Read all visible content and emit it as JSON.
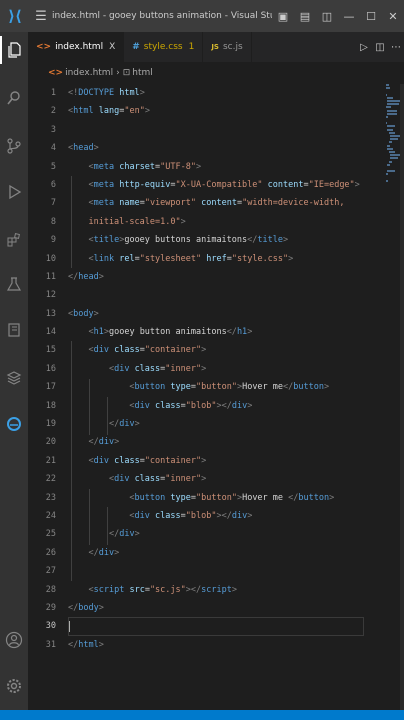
{
  "window": {
    "title": "index.html - gooey buttons animation - Visual Studio Code"
  },
  "tabs": [
    {
      "name": "index.html",
      "icon": "<>",
      "active": true,
      "close": "X"
    },
    {
      "name": "style.css",
      "icon": "#",
      "badge": "1"
    },
    {
      "name": "sc.js",
      "icon": "JS"
    }
  ],
  "breadcrumb": {
    "file": "index.html",
    "element": "html"
  },
  "lines": [
    [
      [
        "p",
        "<!"
      ],
      [
        "t",
        "DOCTYPE"
      ],
      [
        "x",
        " "
      ],
      [
        "a",
        "html"
      ],
      [
        "p",
        ">"
      ]
    ],
    [
      [
        "p",
        "<"
      ],
      [
        "t",
        "html"
      ],
      [
        "x",
        " "
      ],
      [
        "a",
        "lang"
      ],
      [
        "x",
        "="
      ],
      [
        "v",
        "\"en\""
      ],
      [
        "p",
        ">"
      ]
    ],
    [],
    [
      [
        "p",
        "<"
      ],
      [
        "t",
        "head"
      ],
      [
        "p",
        ">"
      ]
    ],
    [
      [
        "x",
        "    "
      ],
      [
        "p",
        "<"
      ],
      [
        "t",
        "meta"
      ],
      [
        "x",
        " "
      ],
      [
        "a",
        "charset"
      ],
      [
        "x",
        "="
      ],
      [
        "v",
        "\"UTF-8\""
      ],
      [
        "p",
        ">"
      ]
    ],
    [
      [
        "x",
        "    "
      ],
      [
        "p",
        "<"
      ],
      [
        "t",
        "meta"
      ],
      [
        "x",
        " "
      ],
      [
        "a",
        "http-equiv"
      ],
      [
        "x",
        "="
      ],
      [
        "v",
        "\"X-UA-Compatible\""
      ],
      [
        "x",
        " "
      ],
      [
        "a",
        "content"
      ],
      [
        "x",
        "="
      ],
      [
        "v",
        "\"IE=edge\""
      ],
      [
        "p",
        ">"
      ]
    ],
    [
      [
        "x",
        "    "
      ],
      [
        "p",
        "<"
      ],
      [
        "t",
        "meta"
      ],
      [
        "x",
        " "
      ],
      [
        "a",
        "name"
      ],
      [
        "x",
        "="
      ],
      [
        "v",
        "\"viewport\""
      ],
      [
        "x",
        " "
      ],
      [
        "a",
        "content"
      ],
      [
        "x",
        "="
      ],
      [
        "v",
        "\"width=device-width,"
      ]
    ],
    [
      [
        "v",
        "    initial-scale=1.0\""
      ],
      [
        "p",
        ">"
      ]
    ],
    [
      [
        "x",
        "    "
      ],
      [
        "p",
        "<"
      ],
      [
        "t",
        "title"
      ],
      [
        "p",
        ">"
      ],
      [
        "x",
        "gooey buttons animaitons"
      ],
      [
        "p",
        "</"
      ],
      [
        "t",
        "title"
      ],
      [
        "p",
        ">"
      ]
    ],
    [
      [
        "x",
        "    "
      ],
      [
        "p",
        "<"
      ],
      [
        "t",
        "link"
      ],
      [
        "x",
        " "
      ],
      [
        "a",
        "rel"
      ],
      [
        "x",
        "="
      ],
      [
        "v",
        "\"stylesheet\""
      ],
      [
        "x",
        " "
      ],
      [
        "a",
        "href"
      ],
      [
        "x",
        "="
      ],
      [
        "v",
        "\"style.css\""
      ],
      [
        "p",
        ">"
      ]
    ],
    [
      [
        "p",
        "</"
      ],
      [
        "t",
        "head"
      ],
      [
        "p",
        ">"
      ]
    ],
    [],
    [
      [
        "p",
        "<"
      ],
      [
        "t",
        "body"
      ],
      [
        "p",
        ">"
      ]
    ],
    [
      [
        "x",
        "    "
      ],
      [
        "p",
        "<"
      ],
      [
        "t",
        "h1"
      ],
      [
        "p",
        ">"
      ],
      [
        "x",
        "gooey button animaitons"
      ],
      [
        "p",
        "</"
      ],
      [
        "t",
        "h1"
      ],
      [
        "p",
        ">"
      ]
    ],
    [
      [
        "x",
        "    "
      ],
      [
        "p",
        "<"
      ],
      [
        "t",
        "div"
      ],
      [
        "x",
        " "
      ],
      [
        "a",
        "class"
      ],
      [
        "x",
        "="
      ],
      [
        "v",
        "\"container\""
      ],
      [
        "p",
        ">"
      ]
    ],
    [
      [
        "x",
        "        "
      ],
      [
        "p",
        "<"
      ],
      [
        "t",
        "div"
      ],
      [
        "x",
        " "
      ],
      [
        "a",
        "class"
      ],
      [
        "x",
        "="
      ],
      [
        "v",
        "\"inner\""
      ],
      [
        "p",
        ">"
      ]
    ],
    [
      [
        "x",
        "            "
      ],
      [
        "p",
        "<"
      ],
      [
        "t",
        "button"
      ],
      [
        "x",
        " "
      ],
      [
        "a",
        "type"
      ],
      [
        "x",
        "="
      ],
      [
        "v",
        "\"button\""
      ],
      [
        "p",
        ">"
      ],
      [
        "x",
        "Hover me"
      ],
      [
        "p",
        "</"
      ],
      [
        "t",
        "button"
      ],
      [
        "p",
        ">"
      ]
    ],
    [
      [
        "x",
        "            "
      ],
      [
        "p",
        "<"
      ],
      [
        "t",
        "div"
      ],
      [
        "x",
        " "
      ],
      [
        "a",
        "class"
      ],
      [
        "x",
        "="
      ],
      [
        "v",
        "\"blob\""
      ],
      [
        "p",
        "></"
      ],
      [
        "t",
        "div"
      ],
      [
        "p",
        ">"
      ]
    ],
    [
      [
        "x",
        "        "
      ],
      [
        "p",
        "</"
      ],
      [
        "t",
        "div"
      ],
      [
        "p",
        ">"
      ]
    ],
    [
      [
        "x",
        "    "
      ],
      [
        "p",
        "</"
      ],
      [
        "t",
        "div"
      ],
      [
        "p",
        ">"
      ]
    ],
    [
      [
        "x",
        "    "
      ],
      [
        "p",
        "<"
      ],
      [
        "t",
        "div"
      ],
      [
        "x",
        " "
      ],
      [
        "a",
        "class"
      ],
      [
        "x",
        "="
      ],
      [
        "v",
        "\"container\""
      ],
      [
        "p",
        ">"
      ]
    ],
    [
      [
        "x",
        "        "
      ],
      [
        "p",
        "<"
      ],
      [
        "t",
        "div"
      ],
      [
        "x",
        " "
      ],
      [
        "a",
        "class"
      ],
      [
        "x",
        "="
      ],
      [
        "v",
        "\"inner\""
      ],
      [
        "p",
        ">"
      ]
    ],
    [
      [
        "x",
        "            "
      ],
      [
        "p",
        "<"
      ],
      [
        "t",
        "button"
      ],
      [
        "x",
        " "
      ],
      [
        "a",
        "type"
      ],
      [
        "x",
        "="
      ],
      [
        "v",
        "\"button\""
      ],
      [
        "p",
        ">"
      ],
      [
        "x",
        "Hover me "
      ],
      [
        "p",
        "</"
      ],
      [
        "t",
        "button"
      ],
      [
        "p",
        ">"
      ]
    ],
    [
      [
        "x",
        "            "
      ],
      [
        "p",
        "<"
      ],
      [
        "t",
        "div"
      ],
      [
        "x",
        " "
      ],
      [
        "a",
        "class"
      ],
      [
        "x",
        "="
      ],
      [
        "v",
        "\"blob\""
      ],
      [
        "p",
        "></"
      ],
      [
        "t",
        "div"
      ],
      [
        "p",
        ">"
      ]
    ],
    [
      [
        "x",
        "        "
      ],
      [
        "p",
        "</"
      ],
      [
        "t",
        "div"
      ],
      [
        "p",
        ">"
      ]
    ],
    [
      [
        "x",
        "    "
      ],
      [
        "p",
        "</"
      ],
      [
        "t",
        "div"
      ],
      [
        "p",
        ">"
      ]
    ],
    [],
    [
      [
        "x",
        "    "
      ],
      [
        "p",
        "<"
      ],
      [
        "t",
        "script"
      ],
      [
        "x",
        " "
      ],
      [
        "a",
        "src"
      ],
      [
        "x",
        "="
      ],
      [
        "v",
        "\"sc.js\""
      ],
      [
        "p",
        "></"
      ],
      [
        "t",
        "script"
      ],
      [
        "p",
        ">"
      ]
    ],
    [
      [
        "p",
        "</"
      ],
      [
        "t",
        "body"
      ],
      [
        "p",
        ">"
      ]
    ],
    [],
    [
      [
        "p",
        "</"
      ],
      [
        "t",
        "html"
      ],
      [
        "p",
        ">"
      ]
    ]
  ],
  "current_line": 30,
  "colors": {
    "tag": "#569cd6",
    "attr": "#9cdcfe",
    "value": "#ce9178",
    "text": "#d4d4d4",
    "punct": "#808080",
    "status": "#007acc"
  }
}
